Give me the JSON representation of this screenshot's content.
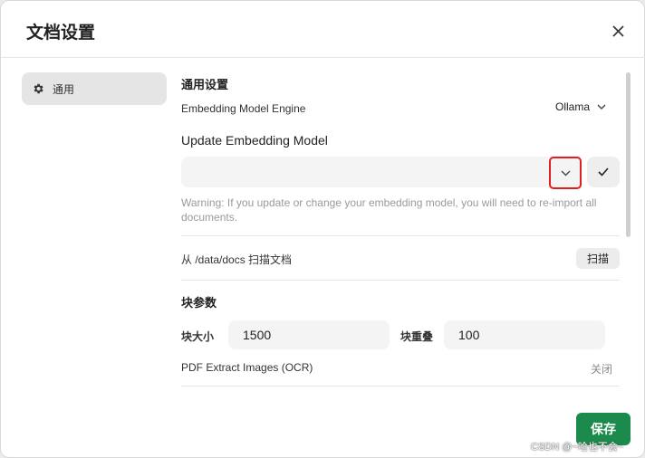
{
  "dialog": {
    "title": "文档设置"
  },
  "sidebar": {
    "items": [
      {
        "label": "通用",
        "icon": "gear-icon"
      }
    ]
  },
  "general": {
    "section_title": "通用设置",
    "engine_label": "Embedding Model Engine",
    "engine_value": "Ollama",
    "update_model_title": "Update Embedding Model",
    "model_input_value": "",
    "warning": "Warning: If you update or change your embedding model, you will need to re-import all documents.",
    "scan_label": "从 /data/docs 扫描文档",
    "scan_button": "扫描"
  },
  "chunk": {
    "section_title": "块参数",
    "size_label": "块大小",
    "size_value": "1500",
    "overlap_label": "块重叠",
    "overlap_value": "100",
    "pdf_label": "PDF Extract Images (OCR)",
    "pdf_toggle": "关闭"
  },
  "footer": {
    "save_label": "保存"
  },
  "watermark": "CSDN @~哈也不会~"
}
